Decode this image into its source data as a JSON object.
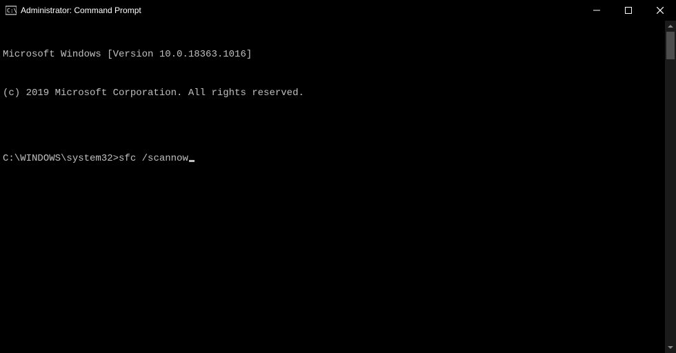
{
  "titlebar": {
    "title": "Administrator: Command Prompt"
  },
  "terminal": {
    "line1": "Microsoft Windows [Version 10.0.18363.1016]",
    "line2": "(c) 2019 Microsoft Corporation. All rights reserved.",
    "blank": "",
    "prompt": "C:\\WINDOWS\\system32>",
    "command": "sfc /scannow"
  }
}
